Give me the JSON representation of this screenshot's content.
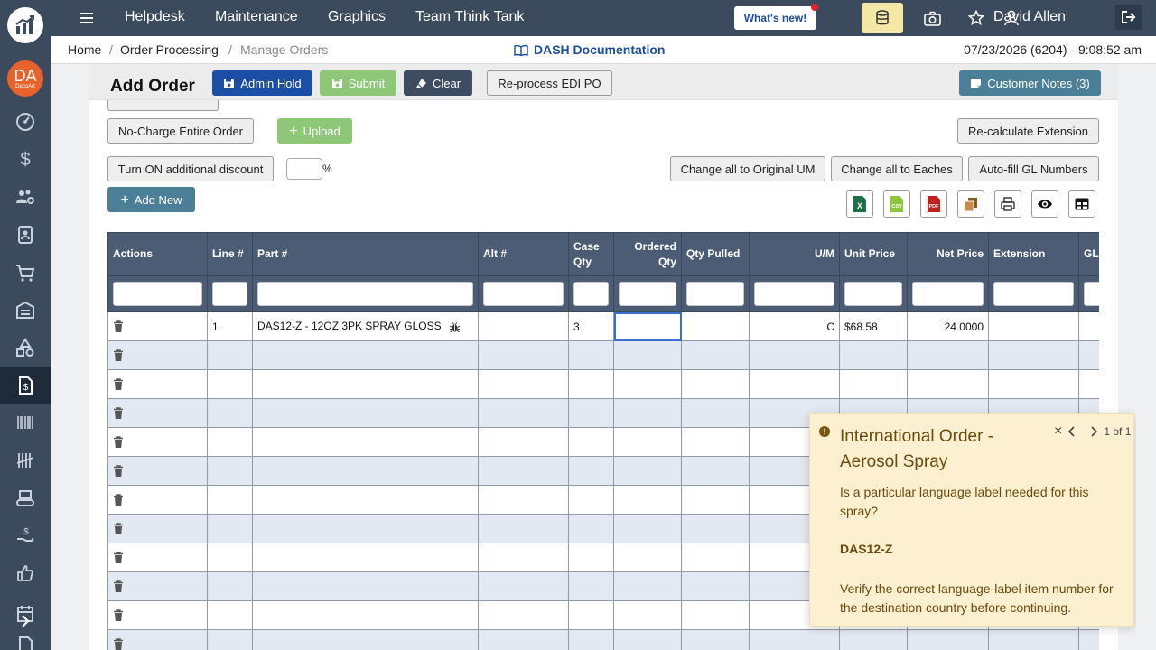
{
  "sidebar": {
    "avatar_initials": "DA",
    "avatar_sub": "DecoArt"
  },
  "topnav": {
    "links": [
      "Helpdesk",
      "Maintenance",
      "Graphics",
      "Team Think Tank"
    ],
    "whats_new": "What's new!",
    "user_name": "David Allen"
  },
  "breadcrumb": {
    "home": "Home",
    "order_processing": "Order Processing",
    "manage_orders": "Manage Orders",
    "sep": "/",
    "docs_link": "DASH Documentation",
    "datetime": "07/23/2026 (6204) - 9:08:52 am"
  },
  "page": {
    "title": "Add Order",
    "admin_hold": "Admin Hold",
    "submit": "Submit",
    "clear": "Clear",
    "reprocess": "Re-process EDI PO",
    "customer_notes": "Customer Notes (3)",
    "no_charge": "No-Charge Entire Order",
    "upload": "Upload",
    "recalc": "Re-calculate Extension",
    "turn_on_discount": "Turn ON additional discount",
    "pct_sign": "%",
    "change_original_um": "Change all to Original UM",
    "change_eaches": "Change all to Eaches",
    "autofill_gl": "Auto-fill GL Numbers",
    "add_new": "Add New"
  },
  "table": {
    "headers": {
      "actions": "Actions",
      "line": "Line #",
      "part": "Part #",
      "alt": "Alt #",
      "case_qty_1": "Case",
      "case_qty_2": "Qty",
      "ordered_qty_1": "Ordered",
      "ordered_qty_2": "Qty",
      "qty_pulled": "Qty Pulled",
      "um": "U/M",
      "unit_price": "Unit Price",
      "net_price": "Net Price",
      "extension": "Extension",
      "gl": "GL"
    },
    "rows": [
      {
        "line": "1",
        "part": "DAS12-Z - 12OZ 3PK SPRAY GLOSS",
        "alt": "",
        "case_qty": "3",
        "ordered_qty": "",
        "qty_pulled": "",
        "um": "C",
        "unit_price": "$68.58",
        "net_price": "24.0000",
        "extension": ""
      }
    ],
    "empty_rows": 11
  },
  "popover": {
    "title": "International Order - Aerosol Spray",
    "counter": "1 of 1",
    "body": "Is a particular language label needed for this spray?",
    "item": "DAS12-Z",
    "note": "Verify the correct language-label item number for the destination country before continuing."
  },
  "colors": {
    "nav_bg": "#3c4a5e",
    "primary_blue": "#1b4fa6",
    "success_green": "#8fc778",
    "teal": "#4b7f97",
    "popover_bg": "#fdf0d0",
    "popover_text": "#6b4a0e",
    "avatar_orange": "#e8622c"
  }
}
